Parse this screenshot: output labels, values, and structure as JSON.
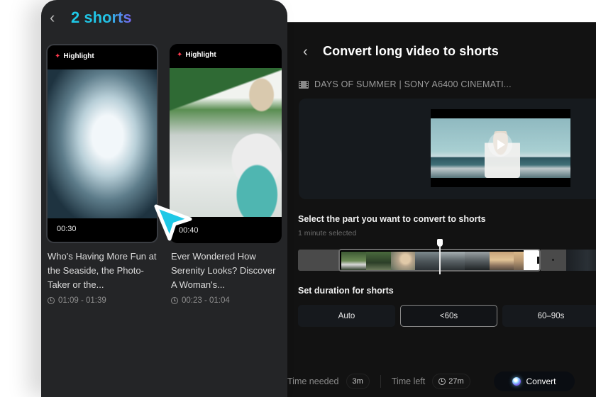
{
  "left_panel": {
    "back_icon": "chevron-left-icon",
    "title": "2 shorts",
    "title_gradient": [
      "#1ec8e6",
      "#7a62f0"
    ],
    "cards": [
      {
        "badge": "Highlight",
        "badge_icon": "sparkle-icon",
        "duration": "00:30",
        "title": "Who's Having More Fun at the Seaside, the Photo-Taker or the...",
        "range": "01:09 - 01:39",
        "selected": true
      },
      {
        "badge": "Highlight",
        "badge_icon": "sparkle-icon",
        "duration": "00:40",
        "title": "Ever Wondered How Serenity Looks? Discover A Woman's...",
        "range": "00:23 - 01:04",
        "selected": false
      }
    ]
  },
  "right_panel": {
    "back_icon": "chevron-left-icon",
    "title": "Convert long video to shorts",
    "source_icon": "film-icon",
    "source_name": "DAYS OF SUMMER | SONY A6400 CINEMATI...",
    "select_label": "Select the part you want to convert to shorts",
    "selected_text": "1 minute selected",
    "duration_label": "Set duration for shorts",
    "duration_options": [
      {
        "label": "Auto",
        "active": false
      },
      {
        "label": "<60s",
        "active": true
      },
      {
        "label": "60–90s",
        "active": false
      }
    ],
    "footer": {
      "time_needed_label": "Time needed",
      "time_needed_value": "3m",
      "time_left_label": "Time left",
      "time_left_value": "27m",
      "convert_label": "Convert"
    }
  },
  "colors": {
    "accent_cyan": "#1ec8e6",
    "accent_violet": "#7a62f0",
    "highlight_red": "#ff3b4f",
    "cursor": "#1ec8e6"
  }
}
